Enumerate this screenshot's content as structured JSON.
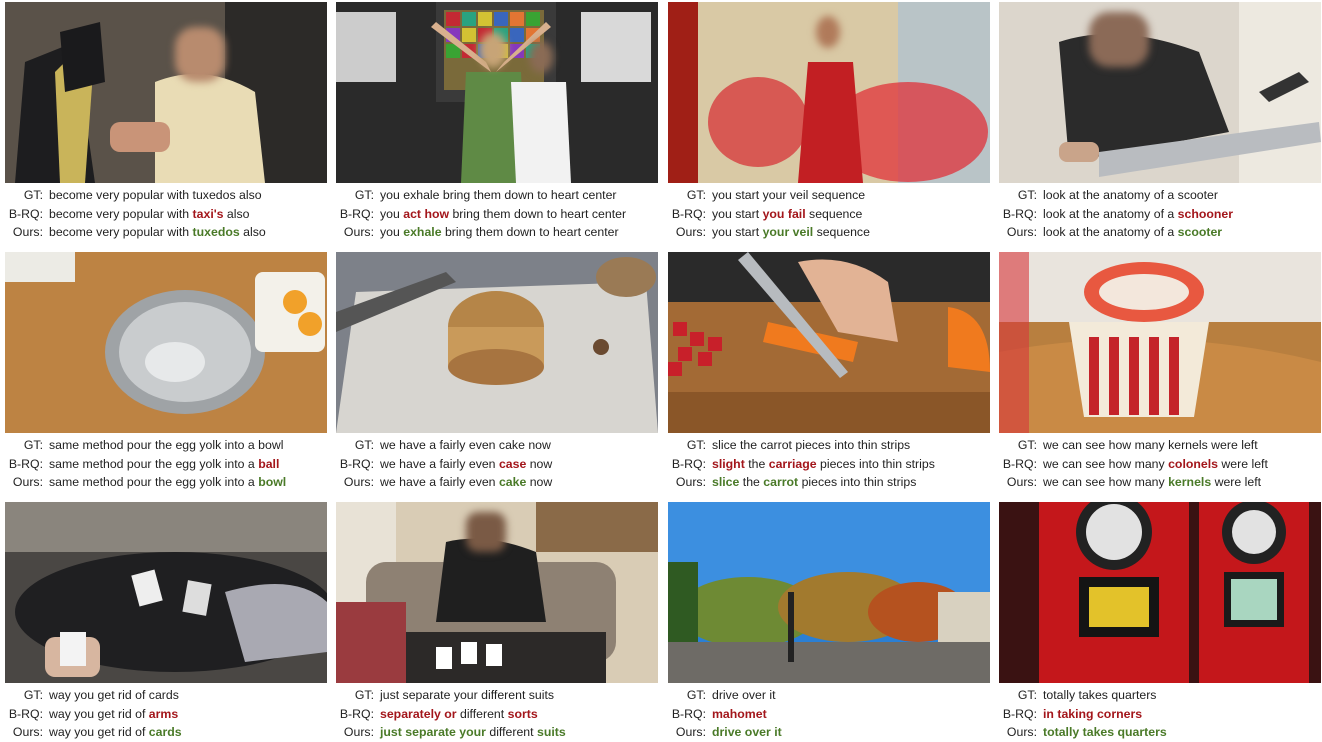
{
  "colors": {
    "wrong": "#a3161b",
    "correct": "#4a7a28"
  },
  "cells": [
    {
      "image": "tuxedo-shop-photo",
      "gt_label": "GT:",
      "gt": "become very popular with tuxedos also",
      "brq_label": "B-RQ:",
      "brq": [
        [
          "become very popular with ",
          "plain"
        ],
        [
          "taxi's",
          "red"
        ],
        [
          " also",
          "plain"
        ]
      ],
      "ours_label": "Ours:",
      "ours": [
        [
          "become very popular with ",
          "plain"
        ],
        [
          "tuxedos",
          "green"
        ],
        [
          " also",
          "plain"
        ]
      ]
    },
    {
      "image": "yoga-class-photo",
      "gt_label": "GT:",
      "gt": "you exhale bring them down to heart center",
      "brq_label": "B-RQ:",
      "brq": [
        [
          "you ",
          "plain"
        ],
        [
          "act how",
          "red"
        ],
        [
          " bring them down to heart center",
          "plain"
        ]
      ],
      "ours_label": "Ours:",
      "ours": [
        [
          "you ",
          "plain"
        ],
        [
          "exhale",
          "green"
        ],
        [
          " bring them down to heart center",
          "plain"
        ]
      ]
    },
    {
      "image": "veil-dancer-photo",
      "gt_label": "GT:",
      "gt": "you start your veil sequence",
      "brq_label": "B-RQ:",
      "brq": [
        [
          "you start ",
          "plain"
        ],
        [
          "you fail",
          "red"
        ],
        [
          " sequence",
          "plain"
        ]
      ],
      "ours_label": "Ours:",
      "ours": [
        [
          "you start ",
          "plain"
        ],
        [
          "your veil",
          "green"
        ],
        [
          " sequence",
          "plain"
        ]
      ]
    },
    {
      "image": "scooter-photo",
      "gt_label": "GT:",
      "gt": "look at the anatomy of a scooter",
      "brq_label": "B-RQ:",
      "brq": [
        [
          "look at the anatomy of a ",
          "plain"
        ],
        [
          "schooner",
          "red"
        ]
      ],
      "ours_label": "Ours:",
      "ours": [
        [
          "look at the anatomy of a ",
          "plain"
        ],
        [
          "scooter",
          "green"
        ]
      ]
    },
    {
      "image": "steel-bowl-photo",
      "gt_label": "GT:",
      "gt": "same method pour the egg yolk into a bowl",
      "brq_label": "B-RQ:",
      "brq": [
        [
          "same method pour the egg yolk into a ",
          "plain"
        ],
        [
          "ball",
          "red"
        ]
      ],
      "ours_label": "Ours:",
      "ours": [
        [
          "same method pour the egg yolk into a ",
          "plain"
        ],
        [
          "bowl",
          "green"
        ]
      ]
    },
    {
      "image": "cake-photo",
      "gt_label": "GT:",
      "gt": "we have a fairly even cake now",
      "brq_label": "B-RQ:",
      "brq": [
        [
          "we have a fairly even ",
          "plain"
        ],
        [
          "case",
          "red"
        ],
        [
          " now",
          "plain"
        ]
      ],
      "ours_label": "Ours:",
      "ours": [
        [
          "we have a fairly even ",
          "plain"
        ],
        [
          "cake",
          "green"
        ],
        [
          " now",
          "plain"
        ]
      ]
    },
    {
      "image": "carrot-cutting-photo",
      "gt_label": "GT:",
      "gt": "slice the carrot pieces into thin strips",
      "brq_label": "B-RQ:",
      "brq": [
        [
          "slight",
          "red"
        ],
        [
          " the ",
          "plain"
        ],
        [
          "carriage",
          "red"
        ],
        [
          " pieces into thin strips",
          "plain"
        ]
      ],
      "ours_label": "Ours:",
      "ours": [
        [
          "slice",
          "green"
        ],
        [
          " the ",
          "plain"
        ],
        [
          "carrot",
          "green"
        ],
        [
          " pieces into thin strips",
          "plain"
        ]
      ]
    },
    {
      "image": "popcorn-bowl-photo",
      "gt_label": "GT:",
      "gt": "we can see how many kernels were left",
      "brq_label": "B-RQ:",
      "brq": [
        [
          "we can see how many ",
          "plain"
        ],
        [
          "colonels",
          "red"
        ],
        [
          " were left",
          "plain"
        ]
      ],
      "ours_label": "Ours:",
      "ours": [
        [
          "we can see how many ",
          "plain"
        ],
        [
          "kernels",
          "green"
        ],
        [
          " were left",
          "plain"
        ]
      ]
    },
    {
      "image": "card-game-photo",
      "gt_label": "GT:",
      "gt": "way you get rid of cards",
      "brq_label": "B-RQ:",
      "brq": [
        [
          "way you get rid of ",
          "plain"
        ],
        [
          "arms",
          "red"
        ]
      ],
      "ours_label": "Ours:",
      "ours": [
        [
          "way you get rid of ",
          "plain"
        ],
        [
          "cards",
          "green"
        ]
      ]
    },
    {
      "image": "card-sorting-photo",
      "gt_label": "GT:",
      "gt": "just separate your different suits",
      "brq_label": "B-RQ:",
      "brq": [
        [
          "separately or",
          "red"
        ],
        [
          " different ",
          "plain"
        ],
        [
          "sorts",
          "red"
        ]
      ],
      "ours_label": "Ours:",
      "ours": [
        [
          "just separate your",
          "green"
        ],
        [
          " different ",
          "plain"
        ],
        [
          "suits",
          "green"
        ]
      ]
    },
    {
      "image": "park-drive-photo",
      "gt_label": "GT:",
      "gt": "drive over it",
      "brq_label": "B-RQ:",
      "brq": [
        [
          "mahomet",
          "red"
        ]
      ],
      "ours_label": "Ours:",
      "ours": [
        [
          "drive over it",
          "green"
        ]
      ]
    },
    {
      "image": "dart-machine-photo",
      "gt_label": "GT:",
      "gt": "totally takes quarters",
      "brq_label": "B-RQ:",
      "brq": [
        [
          "in taking corners",
          "red"
        ]
      ],
      "ours_label": "Ours:",
      "ours": [
        [
          "totally takes quarters",
          "green"
        ]
      ]
    }
  ]
}
